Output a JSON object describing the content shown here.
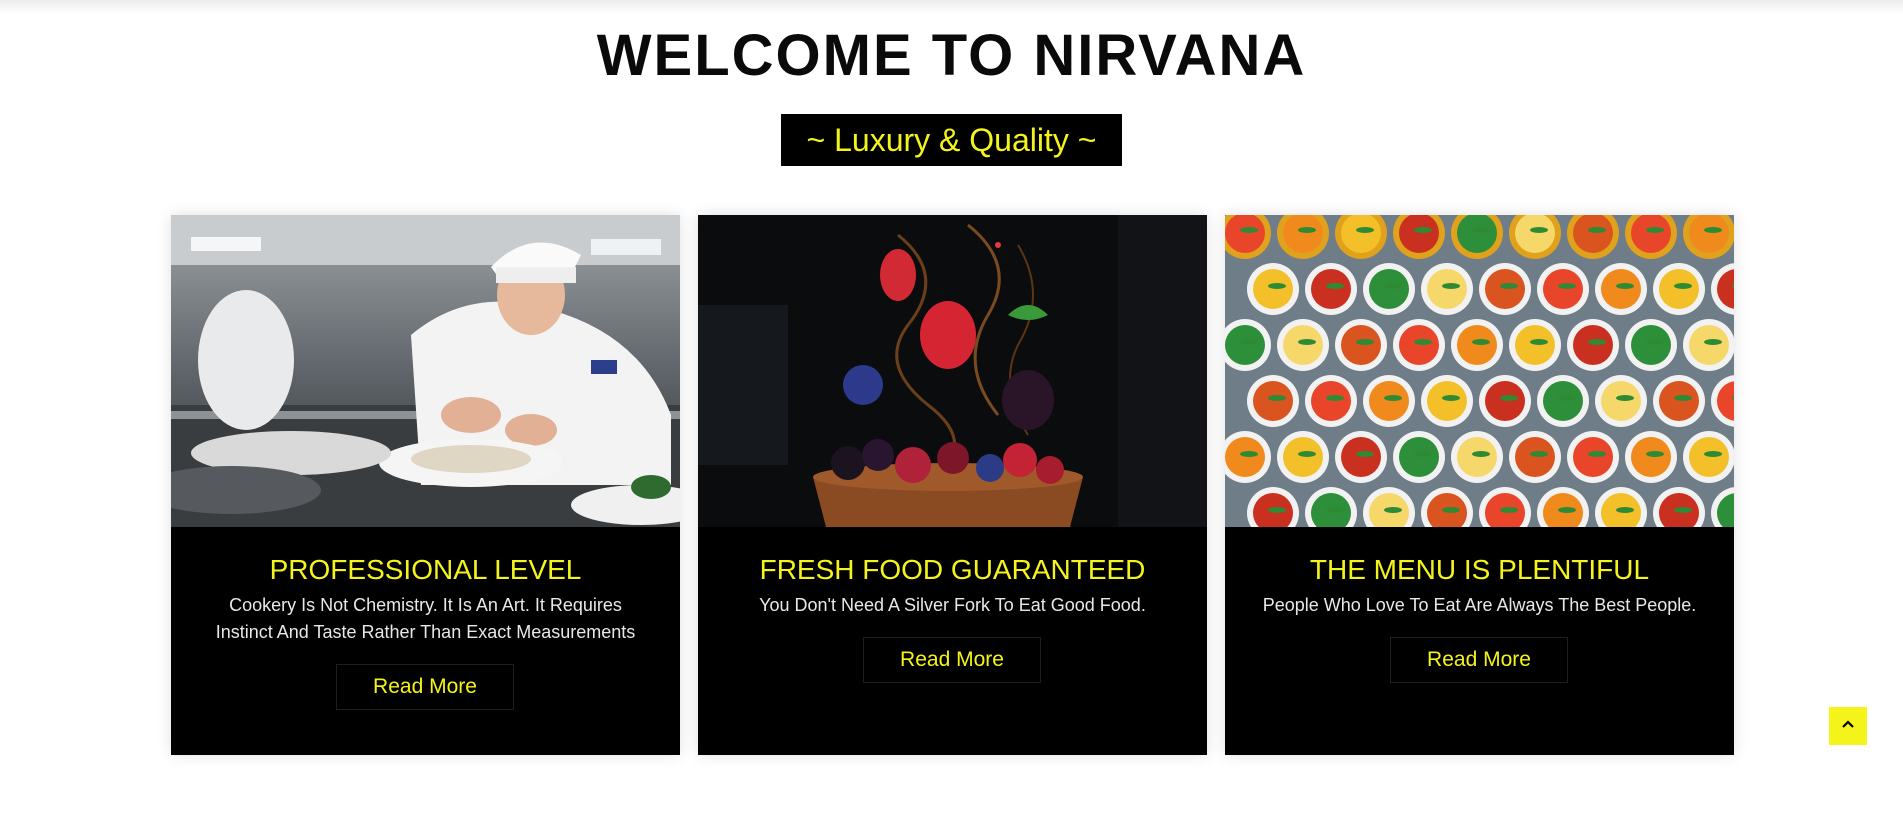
{
  "header": {
    "title": "WELCOME TO NIRVANA",
    "tagline": "~ Luxury & Quality ~"
  },
  "cards": [
    {
      "title": "PROFESSIONAL LEVEL",
      "text": "Cookery Is Not Chemistry. It Is An Art. It Requires Instinct And Taste Rather Than Exact Measurements",
      "button": "Read More"
    },
    {
      "title": "FRESH FOOD GUARANTEED",
      "text": "You Don't Need A Silver Fork To Eat Good Food.",
      "button": "Read More"
    },
    {
      "title": "THE MENU IS PLENTIFUL",
      "text": "People Who Love To Eat Are Always The Best People.",
      "button": "Read More"
    }
  ],
  "scroll_top": {
    "icon": "chevron-up-icon"
  },
  "colors": {
    "accent": "#f4f41a",
    "card_bg": "#000000",
    "title": "#0a0a0a"
  }
}
